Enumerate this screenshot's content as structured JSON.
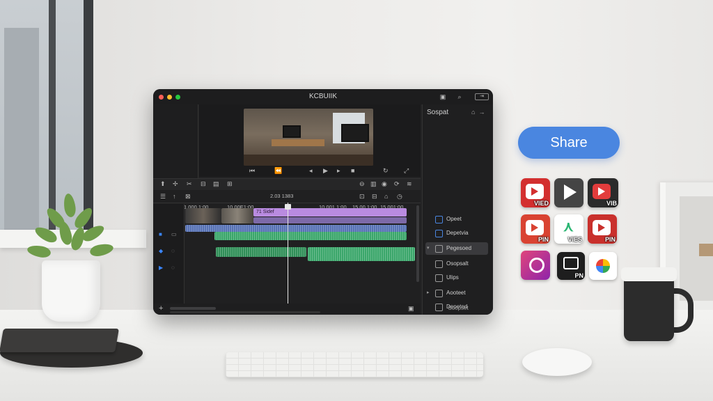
{
  "editor": {
    "app_title": "KCBUIIK",
    "toolbar_timecode": "2.03 1383",
    "ruler": [
      "1.000 1:00",
      "10.00E1:00",
      "10.001 1:00",
      "15.00 1:00",
      "15.001:00"
    ],
    "clip_title": "71 Sidef",
    "inspector": {
      "title": "Sospat",
      "items": [
        {
          "label": "Opeet",
          "selected": false
        },
        {
          "label": "Depetvia",
          "selected": false
        },
        {
          "label": "Pegesoed",
          "selected": true
        },
        {
          "label": "Osopsalt",
          "selected": false
        },
        {
          "label": "Ulips",
          "selected": false
        },
        {
          "label": "Aooteet",
          "selected": false
        },
        {
          "label": "Depeted",
          "selected": false
        }
      ],
      "footer": "Soopset"
    }
  },
  "share": {
    "button_label": "Share",
    "apps": [
      {
        "icon": "video-app-icon",
        "label": "VIED",
        "color": "#d32f2f"
      },
      {
        "icon": "play-app-icon",
        "label": "",
        "color": "#444444"
      },
      {
        "icon": "video-app-icon",
        "label": "VIB",
        "color": "#2b2b2b"
      },
      {
        "icon": "video-pin-icon",
        "label": "PIN",
        "color": "#d94332"
      },
      {
        "icon": "green-arrow-icon",
        "label": "VIES",
        "color": "#ffffff"
      },
      {
        "icon": "video-pin-icon",
        "label": "PIN",
        "color": "#c9302c"
      },
      {
        "icon": "pink-brush-icon",
        "label": "",
        "color": "#c2185b"
      },
      {
        "icon": "pin-app-icon",
        "label": "PN",
        "color": "#1e1e1e"
      },
      {
        "icon": "photos-app-icon",
        "label": "",
        "color": "#ffffff"
      }
    ]
  },
  "colors": {
    "share_button": "#4a86e0",
    "audio_track": "#3aa66a",
    "video_track": "#9b6fc9",
    "selection": "#3a3a3d"
  }
}
